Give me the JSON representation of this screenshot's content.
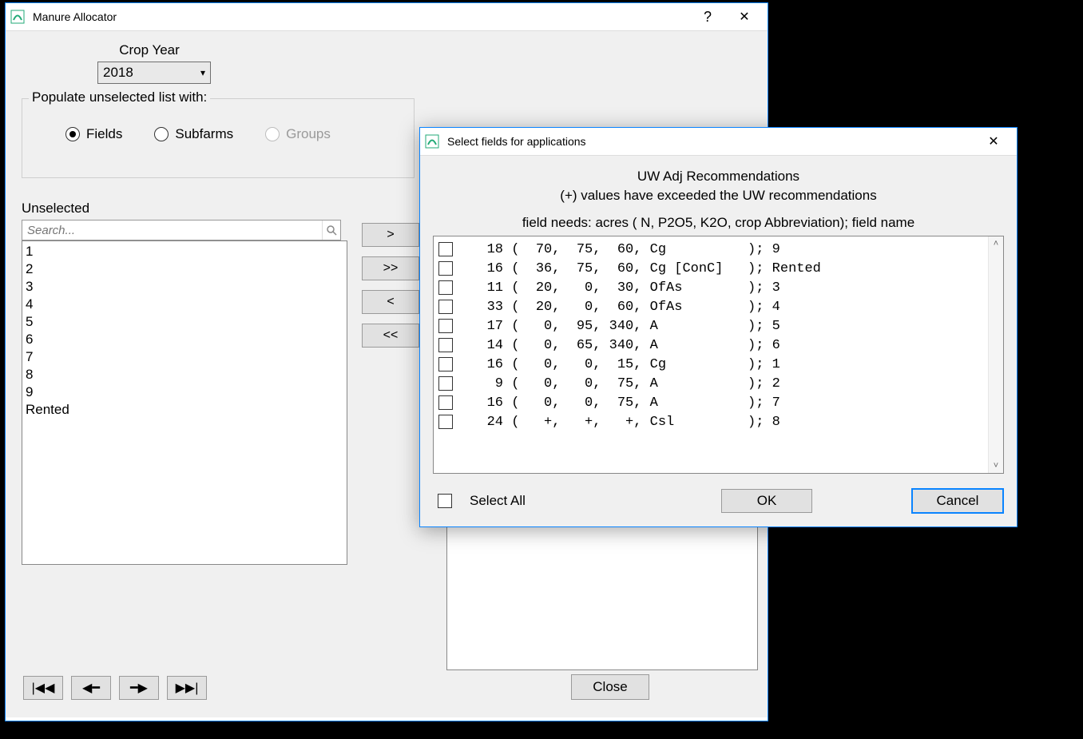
{
  "main_window": {
    "title": "Manure Allocator",
    "crop_year_label": "Crop Year",
    "crop_year_value": "2018",
    "group_title": "Populate unselected list with:",
    "radios": {
      "fields": "Fields",
      "subfarms": "Subfarms",
      "groups": "Groups"
    },
    "unselected_label": "Unselected",
    "search_placeholder": "Search...",
    "unselected_items": [
      "1",
      "2",
      "3",
      "4",
      "5",
      "6",
      "7",
      "8",
      "9",
      "Rented"
    ],
    "move": {
      "right": ">",
      "right_all": ">>",
      "left": "<",
      "left_all": "<<"
    },
    "nav": {
      "first": "|◀◀",
      "prev": "◀━",
      "next": "━▶",
      "last": "▶▶|"
    },
    "close_label": "Close"
  },
  "dialog": {
    "title": "Select fields for applications",
    "header_line1": "UW Adj Recommendations",
    "header_line2": "(+) values have exceeded the UW recommendations",
    "column_legend": "field needs: acres ( N, P2O5, K2O, crop Abbreviation); field name",
    "rows": [
      {
        "acres": "18",
        "n": "70",
        "p": "75",
        "k": "60",
        "crop": "Cg",
        "name": "9"
      },
      {
        "acres": "16",
        "n": "36",
        "p": "75",
        "k": "60",
        "crop": "Cg [ConC]",
        "name": "Rented"
      },
      {
        "acres": "11",
        "n": "20",
        "p": "0",
        "k": "30",
        "crop": "OfAs",
        "name": "3"
      },
      {
        "acres": "33",
        "n": "20",
        "p": "0",
        "k": "60",
        "crop": "OfAs",
        "name": "4"
      },
      {
        "acres": "17",
        "n": "0",
        "p": "95",
        "k": "340",
        "crop": "A",
        "name": "5"
      },
      {
        "acres": "14",
        "n": "0",
        "p": "65",
        "k": "340",
        "crop": "A",
        "name": "6"
      },
      {
        "acres": "16",
        "n": "0",
        "p": "0",
        "k": "15",
        "crop": "Cg",
        "name": "1"
      },
      {
        "acres": "9",
        "n": "0",
        "p": "0",
        "k": "75",
        "crop": "A",
        "name": "2"
      },
      {
        "acres": "16",
        "n": "0",
        "p": "0",
        "k": "75",
        "crop": "A",
        "name": "7"
      },
      {
        "acres": "24",
        "n": "+",
        "p": "+",
        "k": "+",
        "crop": "Csl",
        "name": "8"
      }
    ],
    "select_all_label": "Select All",
    "ok_label": "OK",
    "cancel_label": "Cancel"
  }
}
